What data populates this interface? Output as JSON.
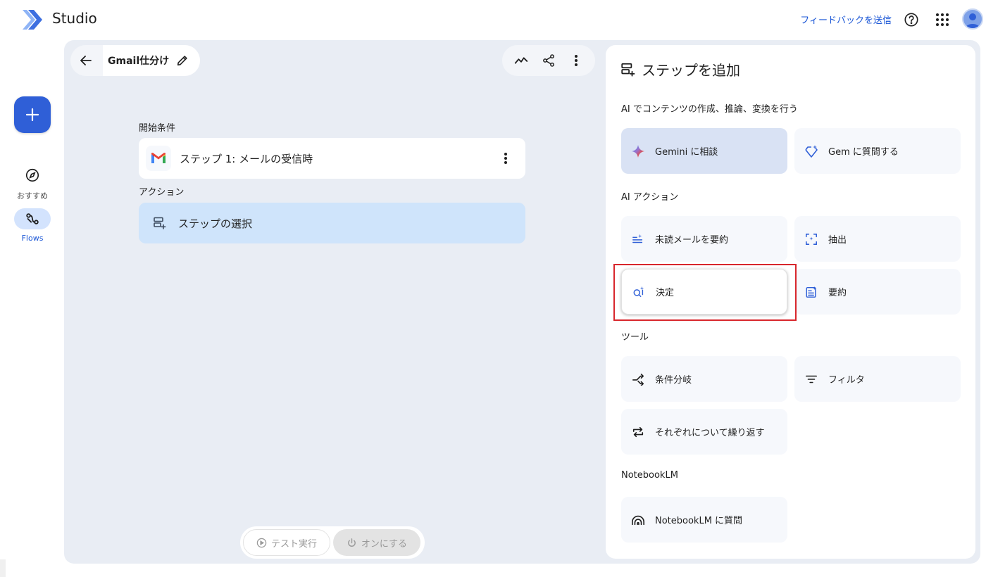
{
  "app": {
    "title": "Studio"
  },
  "header": {
    "feedback_label": "フィードバックを送信",
    "help_icon": "help-circle-icon",
    "apps_icon": "apps-grid-icon",
    "avatar_icon": "user-avatar"
  },
  "sidebar": {
    "create_icon": "plus-icon",
    "items": [
      {
        "label": "おすすめ",
        "icon": "compass-icon",
        "active": false
      },
      {
        "label": "Flows",
        "icon": "flows-icon",
        "active": true
      }
    ]
  },
  "editor": {
    "flow_name": "Gmail仕分け",
    "start_label": "開始条件",
    "start_step": "ステップ 1: メールの受信時",
    "action_label": "アクション",
    "select_step": "ステップの選択",
    "toolbar_icons": [
      "activity-icon",
      "share-icon",
      "more-vert-icon"
    ],
    "test_run_label": "テスト実行",
    "turn_on_label": "オンにする"
  },
  "panel": {
    "title": "ステップを追加",
    "groups": [
      {
        "label": "AI でコンテンツの作成、推論、変換を行う",
        "items": [
          {
            "label": "Gemini に相談",
            "icon": "gemini-sparkle-icon",
            "state": "active"
          },
          {
            "label": "Gem に質問する",
            "icon": "gem-icon",
            "state": "normal"
          }
        ]
      },
      {
        "label": "AI アクション",
        "items": [
          {
            "label": "未読メールを要約",
            "icon": "summarize-list-icon",
            "state": "normal"
          },
          {
            "label": "抽出",
            "icon": "extract-icon",
            "state": "normal"
          },
          {
            "label": "決定",
            "icon": "decide-icon",
            "state": "hover"
          },
          {
            "label": "要約",
            "icon": "summary-doc-icon",
            "state": "normal"
          }
        ]
      },
      {
        "label": "ツール",
        "items": [
          {
            "label": "条件分岐",
            "icon": "branch-icon",
            "state": "normal"
          },
          {
            "label": "フィルタ",
            "icon": "filter-icon",
            "state": "normal"
          },
          {
            "label": "それぞれについて繰り返す",
            "icon": "repeat-icon",
            "state": "normal"
          }
        ]
      },
      {
        "label": "NotebookLM",
        "items": [
          {
            "label": "NotebookLM に質問",
            "icon": "notebooklm-icon",
            "state": "normal"
          }
        ]
      }
    ]
  },
  "colors": {
    "accent": "#2f5fd7",
    "link": "#1a56d6",
    "canvas_bg": "#e9edf4",
    "selected_step": "#cfe4fb",
    "highlight_border": "#d8262c"
  }
}
